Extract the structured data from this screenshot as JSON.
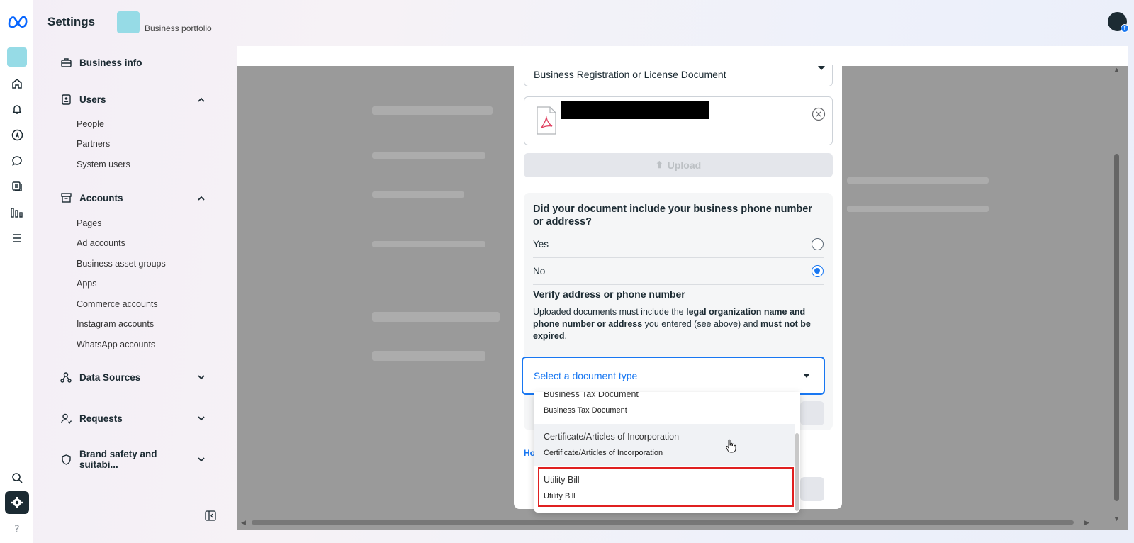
{
  "header": {
    "title": "Settings",
    "portfolio_label": "Business portfolio"
  },
  "sidebar": {
    "business_info": "Business info",
    "users": {
      "label": "Users",
      "items": [
        "People",
        "Partners",
        "System users"
      ]
    },
    "accounts": {
      "label": "Accounts",
      "items": [
        "Pages",
        "Ad accounts",
        "Business asset groups",
        "Apps",
        "Commerce accounts",
        "Instagram accounts",
        "WhatsApp accounts"
      ]
    },
    "data_sources": "Data Sources",
    "requests": "Requests",
    "brand_safety": "Brand safety and suitabi..."
  },
  "modal": {
    "document_type_value": "Business Registration or License Document",
    "upload_label": "Upload",
    "question": "Did your document include your business phone number or address?",
    "options": [
      {
        "label": "Yes",
        "selected": false
      },
      {
        "label": "No",
        "selected": true
      }
    ],
    "verify_heading": "Verify address or phone number",
    "verify_text": {
      "p1": "Uploaded documents must include the ",
      "b1": "legal organization name and phone number or address",
      "p2": " you entered (see above) and ",
      "b2": "must not be expired",
      "p3": "."
    },
    "select_placeholder": "Select a document type",
    "how_link": "Ho"
  },
  "dropdown": {
    "items": [
      {
        "title": "Business Tax Document",
        "subtitle": "Business Tax Document"
      },
      {
        "title": "Certificate/Articles of Incorporation",
        "subtitle": "Certificate/Articles of Incorporation"
      },
      {
        "title": "Utility Bill",
        "subtitle": "Utility Bill"
      }
    ]
  },
  "colors": {
    "accent": "#1877f2",
    "highlight": "#e02020",
    "portfolio": "#96dbe6"
  }
}
